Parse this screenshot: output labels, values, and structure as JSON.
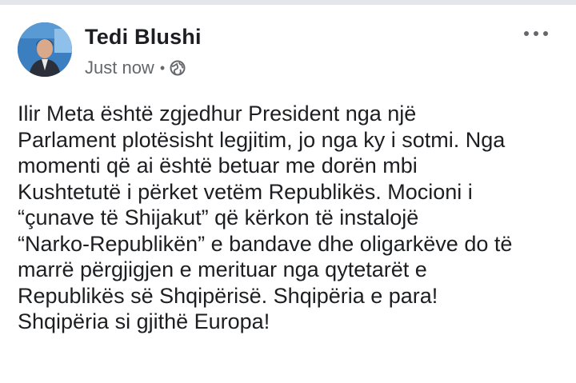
{
  "post": {
    "author": "Tedi Blushi",
    "timestamp": "Just now",
    "separator": "•",
    "audience_icon": "globe-icon",
    "more_icon": "more-horizontal-icon",
    "body_lines": [
      "Ilir Meta është zgjedhur President nga një",
      "Parlament plotësisht legjitim, jo nga ky i sotmi. Nga",
      "momenti që ai është betuar me dorën mbi",
      "Kushtetutë i përket vetëm Republikës. Mocioni i",
      "“çunave të Shijakut” që kërkon të instalojë",
      "“Narko-Republikën” e bandave dhe oligarkëve do të",
      "marrë përgjigjen e merituar nga qytetarët e",
      "Republikës së Shqipërisë. Shqipëria e para!",
      "Shqipëria si gjithë Europa!"
    ]
  },
  "colors": {
    "name": "#1c1e21",
    "meta": "#65676b",
    "text": "#1c1e21",
    "top_strip": "#e4e6eb"
  }
}
